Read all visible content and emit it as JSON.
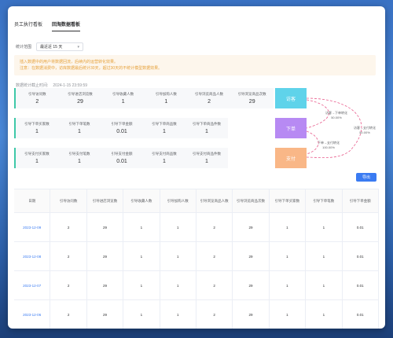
{
  "tabs": [
    {
      "label": "员工执行看板",
      "active": false
    },
    {
      "label": "回淘数据看板",
      "active": true
    }
  ],
  "filter": {
    "label": "统计范围",
    "value": "最近近 15 天"
  },
  "notice": {
    "line1": "插入数据中的用户将数据回流，后续内的运营转化效果。",
    "line2": "注意：在数据消费中，访库数据最后统计30天，超过30天的不统计模型数据效果。"
  },
  "updated": {
    "label": "数据统计截止时间:",
    "value": "2024-1-15 23:59:59"
  },
  "funnel": {
    "visit": {
      "stage": "访客",
      "color": "#5fd3ea",
      "metrics": [
        {
          "label": "引导访问数",
          "value": "2"
        },
        {
          "label": "引导进店浏览数",
          "value": "29"
        },
        {
          "label": "引导收藏人数",
          "value": "1"
        },
        {
          "label": "引导加购人数",
          "value": "1"
        },
        {
          "label": "引导浏览商品人数",
          "value": "2"
        },
        {
          "label": "引导浏览商品次数",
          "value": "29"
        }
      ]
    },
    "order": {
      "stage": "下单",
      "color": "#b78af3",
      "metrics": [
        {
          "label": "引导下单买家数",
          "value": "1"
        },
        {
          "label": "引导下单笔数",
          "value": "1"
        },
        {
          "label": "引导下单金额",
          "value": "0.01"
        },
        {
          "label": "引导下单商品数",
          "value": "1"
        },
        {
          "label": "引导下单商品件数",
          "value": "1"
        }
      ]
    },
    "pay": {
      "stage": "支付",
      "color": "#f9b787",
      "metrics": [
        {
          "label": "引导支付买家数",
          "value": "1"
        },
        {
          "label": "引导支付笔数",
          "value": "1"
        },
        {
          "label": "引导支付金额",
          "value": "0.01"
        },
        {
          "label": "引导支付商品数",
          "value": "1"
        },
        {
          "label": "引导支付商品件数",
          "value": "1"
        }
      ]
    },
    "conversions": [
      {
        "name": "访客→下单转化",
        "value": "50.00%"
      },
      {
        "name": "访客→支付转化",
        "value": "50.00%"
      },
      {
        "name": "下单→支付转化",
        "value": "100.00%"
      }
    ],
    "line_color": "#e85c8c"
  },
  "export_label": "导出",
  "table": {
    "columns": [
      "日期",
      "引导访问数",
      "引导进店浏览数",
      "引导收藏人数",
      "引导加购人数",
      "引导浏览商品人数",
      "引导浏览商品次数",
      "引导下单买家数",
      "引导下单笔数",
      "引导下单金额"
    ],
    "rows": [
      [
        "2023-12-09",
        "2",
        "29",
        "1",
        "1",
        "2",
        "29",
        "1",
        "1",
        "0.01"
      ],
      [
        "2023-12-08",
        "2",
        "29",
        "1",
        "1",
        "2",
        "29",
        "1",
        "1",
        "0.01"
      ],
      [
        "2023-12-07",
        "2",
        "29",
        "1",
        "1",
        "2",
        "29",
        "1",
        "1",
        "0.01"
      ],
      [
        "2023-12-06",
        "2",
        "29",
        "1",
        "1",
        "2",
        "29",
        "1",
        "1",
        "0.01"
      ]
    ]
  },
  "colors": {
    "accent": "#3a7bf2",
    "row_border": "#3ec8a8",
    "notice_text": "#e6a23c"
  }
}
